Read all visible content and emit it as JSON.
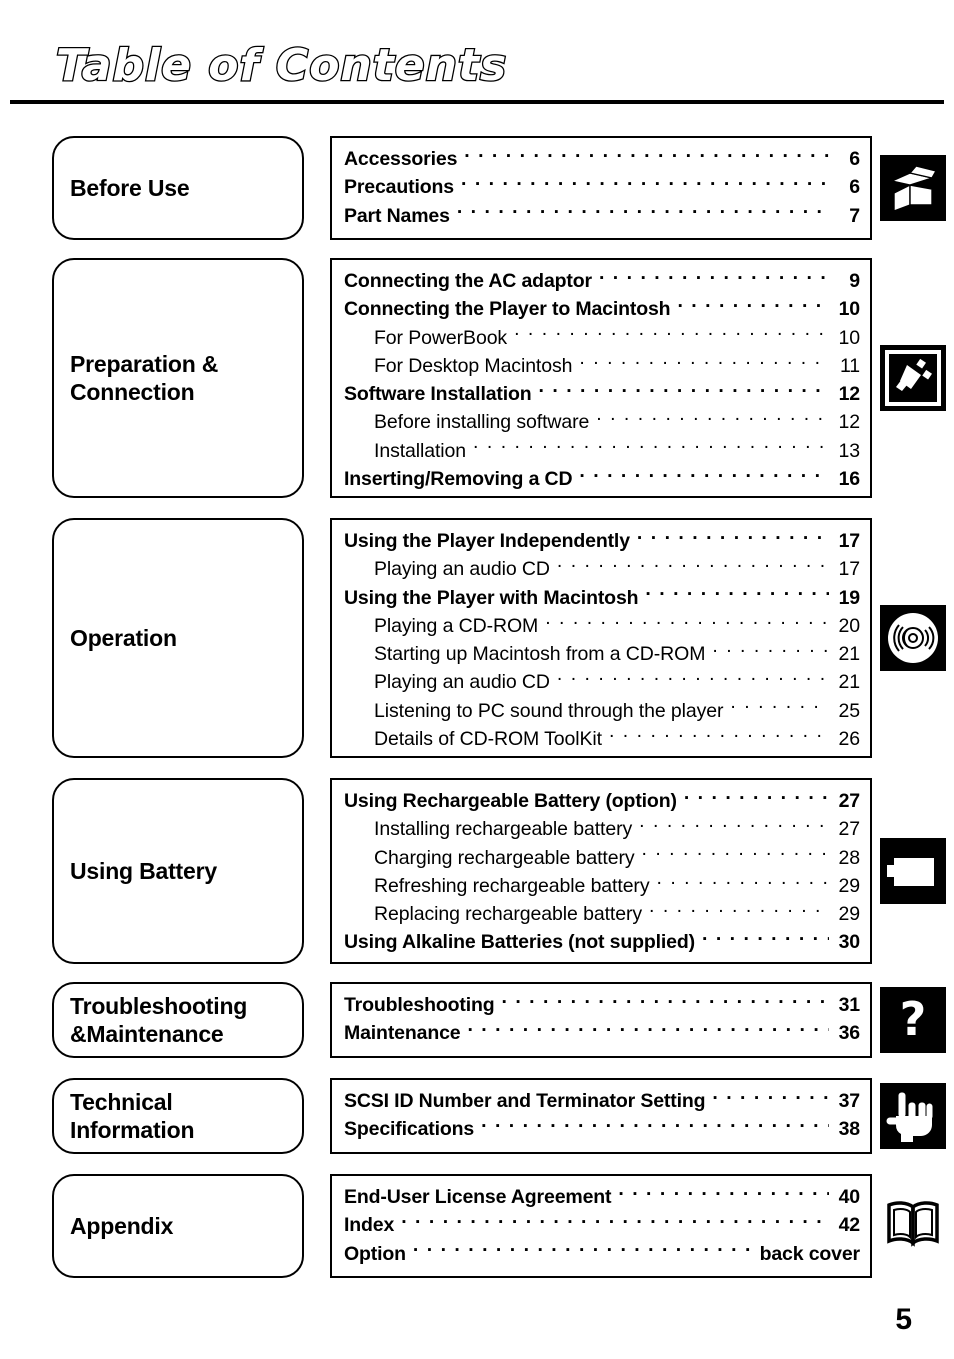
{
  "page": {
    "title": "Table of Contents",
    "page_number": "5"
  },
  "sections": [
    {
      "label": "Before Use",
      "icon": "open-box-icon",
      "entries": [
        {
          "title": "Accessories",
          "page": "6",
          "level": 1
        },
        {
          "title": "Precautions",
          "page": "6",
          "level": 1
        },
        {
          "title": "Part Names",
          "page": "7",
          "level": 1
        }
      ]
    },
    {
      "label": "Preparation &\nConnection",
      "icon": "power-plug-icon",
      "entries": [
        {
          "title": "Connecting the AC adaptor",
          "page": "9",
          "level": 1
        },
        {
          "title": "Connecting the Player to Macintosh",
          "page": "10",
          "level": 1
        },
        {
          "title": "For PowerBook",
          "page": "10",
          "level": 2
        },
        {
          "title": "For Desktop Macintosh",
          "page": "11",
          "level": 2
        },
        {
          "title": "Software Installation",
          "page": "12",
          "level": 1
        },
        {
          "title": "Before installing software",
          "page": "12",
          "level": 2
        },
        {
          "title": "Installation",
          "page": "13",
          "level": 2
        },
        {
          "title": "Inserting/Removing a CD",
          "page": "16",
          "level": 1
        }
      ]
    },
    {
      "label": "Operation",
      "icon": "compact-disc-icon",
      "entries": [
        {
          "title": "Using the Player Independently",
          "page": "17",
          "level": 1
        },
        {
          "title": "Playing an audio CD",
          "page": "17",
          "level": 2
        },
        {
          "title": "Using the Player with Macintosh",
          "page": "19",
          "level": 1
        },
        {
          "title": "Playing a CD-ROM",
          "page": "20",
          "level": 2
        },
        {
          "title": "Starting up Macintosh from a CD-ROM",
          "page": "21",
          "level": 2
        },
        {
          "title": "Playing an audio CD",
          "page": "21",
          "level": 2
        },
        {
          "title": "Listening to PC sound through the player",
          "page": "25",
          "level": 2
        },
        {
          "title": "Details of CD-ROM ToolKit",
          "page": "26",
          "level": 2
        }
      ]
    },
    {
      "label": "Using Battery",
      "icon": "battery-icon",
      "entries": [
        {
          "title": "Using Rechargeable Battery (option)",
          "page": "27",
          "level": 1
        },
        {
          "title": "Installing rechargeable battery",
          "page": "27",
          "level": 2
        },
        {
          "title": "Charging rechargeable battery",
          "page": "28",
          "level": 2
        },
        {
          "title": "Refreshing rechargeable battery",
          "page": "29",
          "level": 2
        },
        {
          "title": "Replacing rechargeable battery",
          "page": "29",
          "level": 2
        },
        {
          "title": "Using Alkaline Batteries (not supplied)",
          "page": "30",
          "level": 1
        }
      ]
    },
    {
      "label": "Troubleshooting\n&Maintenance",
      "icon": "question-mark-icon",
      "entries": [
        {
          "title": "Troubleshooting",
          "page": "31",
          "level": 1
        },
        {
          "title": "Maintenance",
          "page": "36",
          "level": 1
        }
      ]
    },
    {
      "label": "Technical\nInformation",
      "icon": "pointing-hand-icon",
      "entries": [
        {
          "title": "SCSI ID Number and Terminator Setting",
          "page": "37",
          "level": 1
        },
        {
          "title": "Specifications",
          "page": "38",
          "level": 1
        }
      ]
    },
    {
      "label": "Appendix",
      "icon": "open-book-icon",
      "entries": [
        {
          "title": "End-User License Agreement",
          "page": "40",
          "level": 1
        },
        {
          "title": "Index",
          "page": "42",
          "level": 1
        },
        {
          "title": "Option",
          "page": "back cover",
          "level": 1
        }
      ]
    }
  ]
}
